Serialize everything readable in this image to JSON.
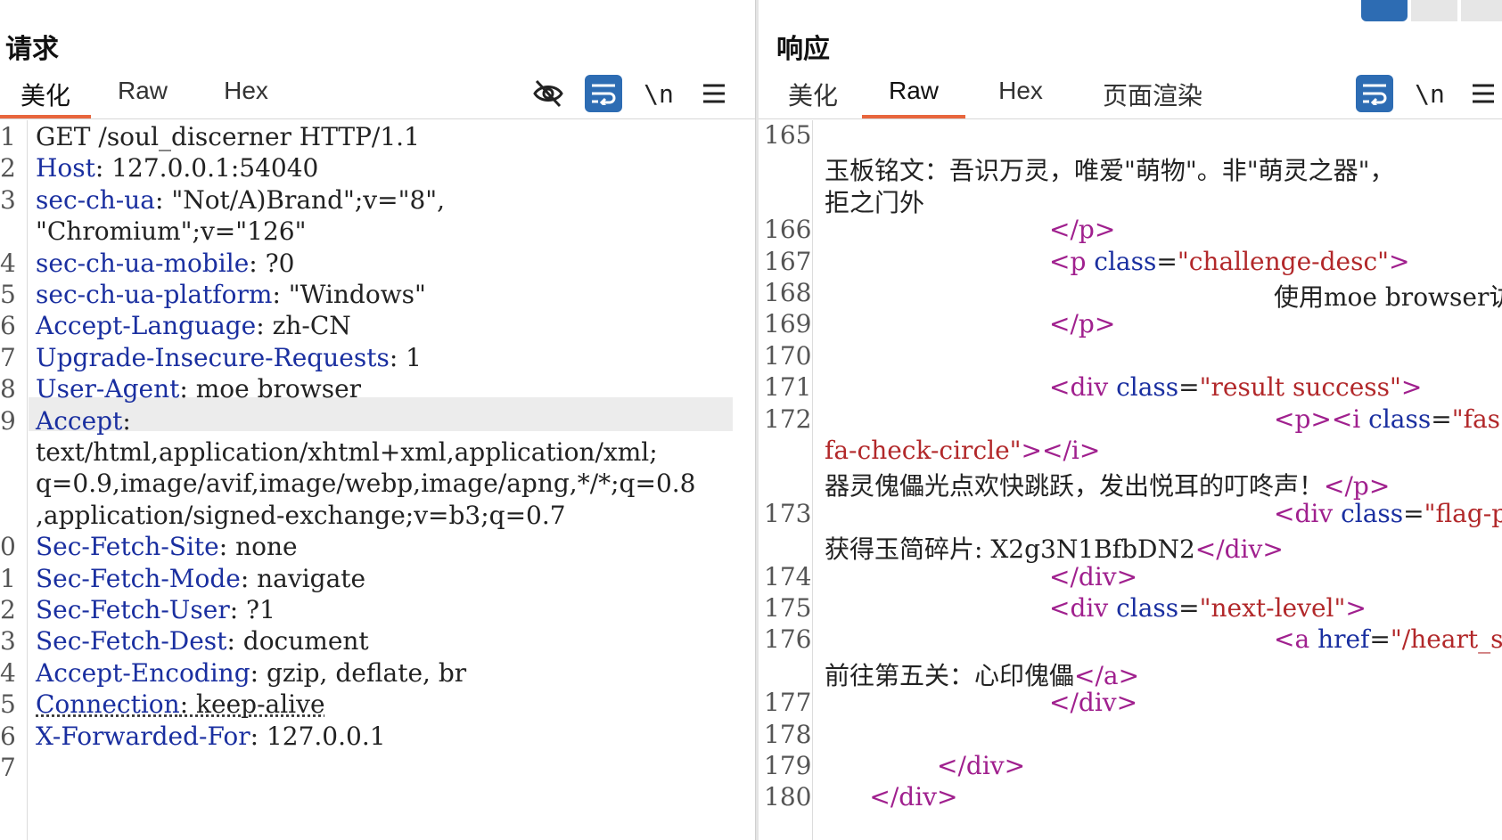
{
  "request": {
    "title": "请求",
    "tabs": [
      {
        "label": "美化",
        "active": true
      },
      {
        "label": "Raw",
        "active": false
      },
      {
        "label": "Hex",
        "active": false
      }
    ],
    "tools": {
      "hide_icon": "eye-off-icon",
      "wrap_icon": "wrap-icon",
      "newline_label": "\\n",
      "menu_icon": "hamburger-menu-icon"
    },
    "lines": [
      {
        "n": "1",
        "name": "",
        "value": "GET /soul_discerner HTTP/1.1"
      },
      {
        "n": "2",
        "name": "Host",
        "value": ": 127.0.0.1:54040"
      },
      {
        "n": "3",
        "name": "sec-ch-ua",
        "value": ": \"Not/A)Brand\";v=\"8\","
      },
      {
        "n": "",
        "name": "",
        "value": "\"Chromium\";v=\"126\""
      },
      {
        "n": "4",
        "name": "sec-ch-ua-mobile",
        "value": ": ?0"
      },
      {
        "n": "5",
        "name": "sec-ch-ua-platform",
        "value": ": \"Windows\""
      },
      {
        "n": "6",
        "name": "Accept-Language",
        "value": ": zh-CN"
      },
      {
        "n": "7",
        "name": "Upgrade-Insecure-Requests",
        "value": ": 1"
      },
      {
        "n": "8",
        "name": "User-Agent",
        "value": ": moe browser"
      },
      {
        "n": "9",
        "name": "Accept",
        "value": ":"
      },
      {
        "n": "",
        "name": "",
        "value": "text/html,application/xhtml+xml,application/xml;"
      },
      {
        "n": "",
        "name": "",
        "value": "q=0.9,image/avif,image/webp,image/apng,*/*;q=0.8"
      },
      {
        "n": "",
        "name": "",
        "value": ",application/signed-exchange;v=b3;q=0.7"
      },
      {
        "n": "0",
        "name": "Sec-Fetch-Site",
        "value": ": none"
      },
      {
        "n": "1",
        "name": "Sec-Fetch-Mode",
        "value": ": navigate"
      },
      {
        "n": "2",
        "name": "Sec-Fetch-User",
        "value": ": ?1"
      },
      {
        "n": "3",
        "name": "Sec-Fetch-Dest",
        "value": ": document"
      },
      {
        "n": "4",
        "name": "Accept-Encoding",
        "value": ": gzip, deflate, br"
      },
      {
        "n": "5",
        "name": "Connection",
        "value": ": keep-alive"
      },
      {
        "n": "6",
        "name": "X-Forwarded-For",
        "value": ": 127.0.0.1"
      },
      {
        "n": "7",
        "name": "",
        "value": ""
      }
    ]
  },
  "response": {
    "title": "响应",
    "tabs": [
      {
        "label": "美化",
        "active": false
      },
      {
        "label": "Raw",
        "active": true
      },
      {
        "label": "Hex",
        "active": false
      },
      {
        "label": "页面渲染",
        "active": false
      }
    ],
    "tools": {
      "wrap_icon": "wrap-icon",
      "newline_label": "\\n",
      "menu_icon": "hamburger-menu-icon"
    },
    "view_icons": [
      "split-view-icon",
      "list-view-icon",
      "panel-view-icon"
    ],
    "lines": [
      {
        "n": "165",
        "segs": []
      },
      {
        "n": "",
        "segs": [
          {
            "t": "text",
            "v": "玉板铭文：吾识万灵，唯爱\"萌物\"。非\"萌灵之器\"，"
          }
        ]
      },
      {
        "n": "",
        "segs": [
          {
            "t": "text",
            "v": "拒之门外"
          }
        ]
      },
      {
        "n": "166",
        "indent": 1,
        "segs": [
          {
            "t": "tag",
            "v": "</p>"
          }
        ]
      },
      {
        "n": "167",
        "indent": 1,
        "segs": [
          {
            "t": "tag",
            "v": "<p "
          },
          {
            "t": "attr",
            "v": "class"
          },
          {
            "t": "text",
            "v": "="
          },
          {
            "t": "val",
            "v": "\"challenge-desc\""
          },
          {
            "t": "tag",
            "v": ">"
          }
        ]
      },
      {
        "n": "168",
        "indent": 2,
        "segs": [
          {
            "t": "text",
            "v": "使用moe browser访问哦"
          }
        ]
      },
      {
        "n": "169",
        "indent": 1,
        "segs": [
          {
            "t": "tag",
            "v": "</p>"
          }
        ]
      },
      {
        "n": "170",
        "segs": []
      },
      {
        "n": "171",
        "indent": 1,
        "segs": [
          {
            "t": "tag",
            "v": "<div "
          },
          {
            "t": "attr",
            "v": "class"
          },
          {
            "t": "text",
            "v": "="
          },
          {
            "t": "val",
            "v": "\"result success\""
          },
          {
            "t": "tag",
            "v": ">"
          }
        ]
      },
      {
        "n": "172",
        "indent": 2,
        "segs": [
          {
            "t": "tag",
            "v": "<p><i "
          },
          {
            "t": "attr",
            "v": "class"
          },
          {
            "t": "text",
            "v": "="
          },
          {
            "t": "val",
            "v": "\"fas"
          }
        ]
      },
      {
        "n": "",
        "segs": [
          {
            "t": "val",
            "v": "fa-check-circle\""
          },
          {
            "t": "tag",
            "v": "></i>"
          }
        ]
      },
      {
        "n": "",
        "segs": [
          {
            "t": "text",
            "v": "器灵傀儡光点欢快跳跃，发出悦耳的叮咚声！"
          },
          {
            "t": "tag",
            "v": "</p>"
          }
        ]
      },
      {
        "n": "173",
        "indent": 2,
        "segs": [
          {
            "t": "tag",
            "v": "<div "
          },
          {
            "t": "attr",
            "v": "class"
          },
          {
            "t": "text",
            "v": "="
          },
          {
            "t": "val",
            "v": "\"flag-piece\""
          },
          {
            "t": "tag",
            "v": ">"
          }
        ]
      },
      {
        "n": "",
        "segs": [
          {
            "t": "text",
            "v": "获得玉简碎片: X2g3N1BfbDN2"
          },
          {
            "t": "tag",
            "v": "</div>"
          }
        ]
      },
      {
        "n": "174",
        "indent": 1,
        "segs": [
          {
            "t": "tag",
            "v": "</div>"
          }
        ]
      },
      {
        "n": "175",
        "indent": 1,
        "segs": [
          {
            "t": "tag",
            "v": "<div "
          },
          {
            "t": "attr",
            "v": "class"
          },
          {
            "t": "text",
            "v": "="
          },
          {
            "t": "val",
            "v": "\"next-level\""
          },
          {
            "t": "tag",
            "v": ">"
          }
        ]
      },
      {
        "n": "176",
        "indent": 2,
        "segs": [
          {
            "t": "tag",
            "v": "<a "
          },
          {
            "t": "attr",
            "v": "href"
          },
          {
            "t": "text",
            "v": "="
          },
          {
            "t": "val",
            "v": "\"/heart_seal\""
          },
          {
            "t": "tag",
            "v": ">"
          }
        ]
      },
      {
        "n": "",
        "segs": [
          {
            "t": "text",
            "v": "前往第五关：心印傀儡"
          },
          {
            "t": "tag",
            "v": "</a>"
          }
        ]
      },
      {
        "n": "177",
        "indent": 1,
        "segs": [
          {
            "t": "tag",
            "v": "</div>"
          }
        ]
      },
      {
        "n": "178",
        "segs": []
      },
      {
        "n": "179",
        "indent": 0.5,
        "segs": [
          {
            "t": "tag",
            "v": "</div>"
          }
        ]
      },
      {
        "n": "180",
        "indent": 0.2,
        "segs": [
          {
            "t": "tag",
            "v": "</div>"
          }
        ]
      }
    ]
  }
}
